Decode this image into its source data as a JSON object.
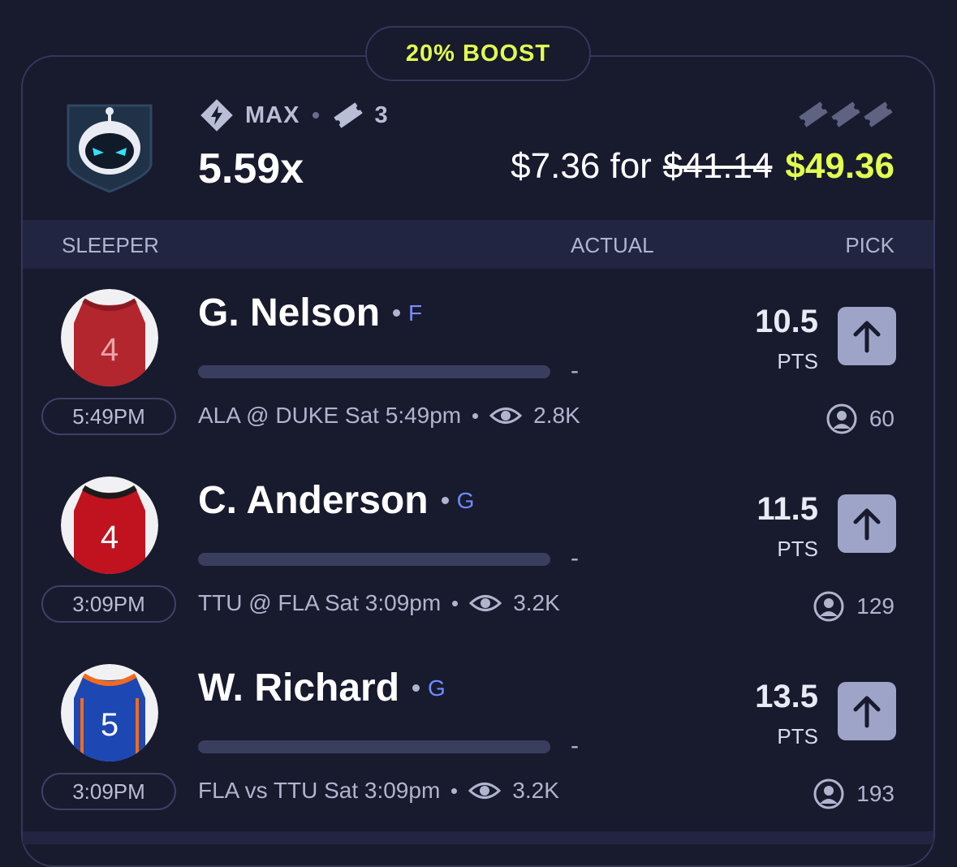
{
  "boost": {
    "label": "20% BOOST"
  },
  "entry": {
    "tier": "MAX",
    "legs_count": "3",
    "multiplier": "5.59x",
    "stake_text": "$7.36 for",
    "original_payout": "$41.14",
    "boosted_payout": "$49.36",
    "accent_color": "#e2ff4f"
  },
  "columns": {
    "left": "SLEEPER",
    "middle": "ACTUAL",
    "right": "PICK"
  },
  "picks": [
    {
      "name": "G. Nelson",
      "position": "F",
      "position_color": "#7b8cff",
      "time": "5:49PM",
      "game": "ALA @ DUKE Sat 5:49pm",
      "views": "2.8K",
      "line": "10.5",
      "stat": "PTS",
      "actual": "-",
      "pickers": "60",
      "jersey_number": "4",
      "jersey_color": "#b3262e",
      "direction": "up"
    },
    {
      "name": "C. Anderson",
      "position": "G",
      "position_color": "#6f8cff",
      "time": "3:09PM",
      "game": "TTU @ FLA Sat 3:09pm",
      "views": "3.2K",
      "line": "11.5",
      "stat": "PTS",
      "actual": "-",
      "pickers": "129",
      "jersey_number": "4",
      "jersey_color": "#c1121f",
      "direction": "up"
    },
    {
      "name": "W. Richard",
      "position": "G",
      "position_color": "#6f8cff",
      "time": "3:09PM",
      "game": "FLA vs TTU Sat 3:09pm",
      "views": "3.2K",
      "line": "13.5",
      "stat": "PTS",
      "actual": "-",
      "pickers": "193",
      "jersey_number": "5",
      "jersey_color": "#1d47b3",
      "direction": "up"
    }
  ]
}
